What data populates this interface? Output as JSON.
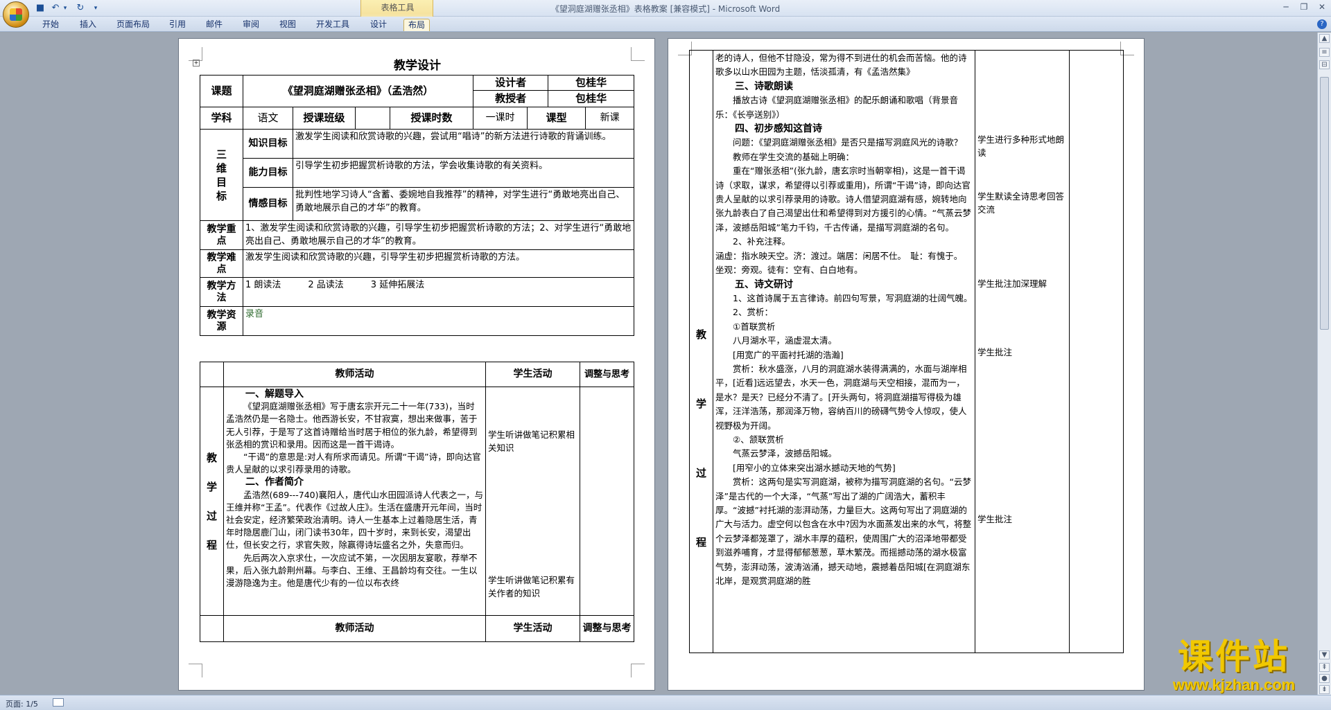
{
  "window": {
    "title": "《望洞庭湖赠张丞相》表格教案 [兼容模式] - Microsoft Word",
    "context_tab_group": "表格工具"
  },
  "ribbon": {
    "tabs": [
      "开始",
      "插入",
      "页面布局",
      "引用",
      "邮件",
      "审阅",
      "视图",
      "开发工具",
      "设计",
      "布局"
    ]
  },
  "status": {
    "page": "页面: 1/5"
  },
  "watermark": {
    "title": "课件站",
    "url": "www.kjzhan.com"
  },
  "page1": {
    "heading": "教学设计",
    "course_label": "课题",
    "course_title": "《望洞庭湖赠张丞相》（孟浩然）",
    "designer_label": "设计者",
    "designer": "包桂华",
    "teacher_label": "教授者",
    "teacher": "包桂华",
    "subject_label": "学科",
    "subject": "语文",
    "class_label": "授课班级",
    "hours_label": "授课时数",
    "hours": "一课时",
    "type_label": "课型",
    "type": "新课",
    "goals_label": [
      "三",
      "维",
      "目",
      "标"
    ],
    "knowledge_label": "知识目标",
    "knowledge": "激发学生阅读和欣赏诗歌的兴趣，尝试用“唱诗”的新方法进行诗歌的背诵训练。",
    "ability_label": "能力目标",
    "ability": "引导学生初步把握赏析诗歌的方法，学会收集诗歌的有关资料。",
    "emotion_label": "情感目标",
    "emotion": "批判性地学习诗人“含蓄、委婉地自我推荐”的精神，对学生进行“勇敢地亮出自己、勇敢地展示自己的才华”的教育。",
    "key_label": "教学重点",
    "key": "1、激发学生阅读和欣赏诗歌的兴趣，引导学生初步把握赏析诗歌的方法；2、对学生进行“勇敢地亮出自己、勇敢地展示自己的才华”的教育。",
    "difficulty_label": "教学难点",
    "difficulty": "激发学生阅读和欣赏诗歌的兴趣，引导学生初步把握赏析诗歌的方法。",
    "method_label": "教学方法",
    "method": "1 朗读法　　　2 品读法　　　3 延伸拓展法",
    "resource_label": "教学资源",
    "resource": "录音",
    "col_teacher": "教师活动",
    "col_student": "学生活动",
    "col_adjust": "调整与思考",
    "process_label": [
      "教",
      "学",
      "过",
      "程"
    ],
    "sec1_title": "一、解题导入",
    "sec1_p1": "《望洞庭湖赠张丞相》写于唐玄宗开元二十一年(733)，当时孟浩然仍是一名隐士。他西游长安，不甘寂寞，想出来做事，苦于无人引荐，于是写了这首诗赠给当时居于相位的张九龄，希望得到张丞相的赏识和录用。因而这是一首干谒诗。",
    "sec1_p2": "“干谒”的意思是:对人有所求而请见。所谓“干谒”诗，即向达官贵人呈献的以求引荐录用的诗歌。",
    "sec2_title": "二、作者简介",
    "sec2_p1": "孟浩然(689---740)襄阳人，唐代山水田园派诗人代表之一，与王维并称“王孟”。代表作《过故人庄》。生活在盛唐开元年间，当时社会安定，经济繁荣政治清明。诗人一生基本上过着隐居生活，青年时隐居鹿门山，闭门读书30年，四十岁时，来到长安，渴望出仕，但长安之行，求官失败，除赢得诗坛盛名之外，失意而归。",
    "sec2_p2": "先后两次入京求仕，一次应试不第，一次因朋友宴歌，荐举不果，后入张九龄荆州幕。与李白、王维、王昌龄均有交往。一生以漫游隐逸为主。他是唐代少有的一位以布衣终",
    "stu1": "学生听讲做笔记积累相关知识",
    "stu2": "学生听讲做笔记积累有关作者的知识"
  },
  "page2": {
    "process_label": [
      "教",
      "学",
      "过",
      "程"
    ],
    "lines_intro": "老的诗人，但他不甘隐没，常为得不到进仕的机会而苦恼。他的诗歌多以山水田园为主题，恬淡孤清，有《孟浩然集》",
    "sec3_title": "三、诗歌朗读",
    "sec3_p": "播放古诗《望洞庭湖赠张丞相》的配乐朗诵和歌唱（背景音乐：《长亭送别》）",
    "sec4_title": "四、初步感知这首诗",
    "sec4_q": "问题：《望洞庭湖赠张丞相》是否只是描写洞庭风光的诗歌？",
    "sec4_a": "教师在学生交流的基础上明确：",
    "sec4_p": "重在“赠张丞相”(张九龄，唐玄宗时当朝宰相)，这是一首干谒诗（求取，谋求，希望得以引荐或重用)，所谓“干谒”诗，即向达官贵人呈献的以求引荐录用的诗歌。诗人借望洞庭湖有感，婉转地向张九龄表白了自己渴望出仕和希望得到对方援引的心情。“气蒸云梦泽，波撼岳阳城”笔力千钧，千古传诵，是描写洞庭湖的名句。",
    "sec4_note": "2、补充注释。",
    "sec4_gloss1": "涵虚：指水映天空。济：渡过。端居：闲居不仕。　耻：有愧于。",
    "sec4_gloss2": "坐观：旁观。徒有：空有、白白地有。",
    "sec5_title": "五、诗文研讨",
    "sec5_p1": "1、这首诗属于五言律诗。前四句写景，写洞庭湖的壮阔气魄。",
    "sec5_p2": "2、赏析：",
    "sec5_sub1": "①首联赏析",
    "sec5_line1": "八月湖水平，涵虚混太清。",
    "sec5_note1": "[用宽广的平面衬托湖的浩瀚]",
    "sec5_p3": "赏析：秋水盛涨，八月的洞庭湖水装得满满的，水面与湖岸相平，[近看]远远望去，水天一色，洞庭湖与天空相接，混而为一，是水？是天？已经分不清了。[开头两句，将洞庭湖描写得极为雄浑，汪洋浩荡，那润泽万物，容纳百川的磅礴气势令人惊叹，使人视野极为开阔。",
    "sec5_sub2": "②、颔联赏析",
    "sec5_line2": "气蒸云梦泽，波撼岳阳城。",
    "sec5_note2": "[用窄小的立体来突出湖水撼动天地的气势]",
    "sec5_p4": "赏析：这两句是实写洞庭湖，被称为描写洞庭湖的名句。“云梦泽”是古代的一个大泽，“气蒸”写出了湖的广阔浩大，蓄积丰厚。“波撼”衬托湖的澎湃动荡，力量巨大。这两句写出了洞庭湖的广大与活力。虚空何以包含在水中?因为水面蒸发出来的水气，将整个云梦泽都笼罩了，湖水丰厚的蕴积，使周围广大的沼泽地带都受到滋养哺育，才显得郁郁葱葱，草木繁茂。而摇撼动荡的湖水极富气势，澎湃动荡，波涛汹涌，撼天动地，震撼着岳阳城[在洞庭湖东北岸，是观赏洞庭湖的胜",
    "stu1": "学生进行多种形式地朗读",
    "stu2": "学生默读全诗思考回答交流",
    "stu3": "学生批注加深理解",
    "stu4": "学生批注",
    "stu5": "学生批注"
  }
}
